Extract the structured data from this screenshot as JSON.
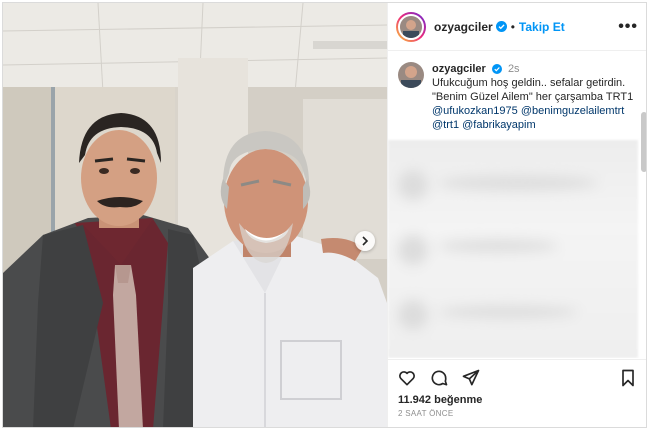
{
  "post": {
    "username": "ozyagciler",
    "follow_label": "Takip Et",
    "separator": "•",
    "more_label": "•••",
    "caption": {
      "username": "ozyagciler",
      "time_ago": "2s",
      "line1": "Ufukcuğum hoş geldin.. sefalar getirdin.",
      "line2": "\"Benim Güzel Ailem\" her çarşamba TRT1",
      "mention1": "@ufukozkan1975",
      "mention2": "@benimguzelailemtrt",
      "mention3": "@trt1",
      "mention4": "@fabrikayapim"
    },
    "likes": "11.942 beğenme",
    "timestamp": "2 SAAT ÖNCE"
  },
  "icons": {
    "verified": "verified-badge-icon",
    "more": "more-options-icon",
    "like": "heart-icon",
    "comment": "comment-icon",
    "share": "share-icon",
    "save": "bookmark-icon",
    "next": "chevron-right-icon"
  },
  "colors": {
    "accent": "#0095f6",
    "mention": "#00376b",
    "muted": "#8e8e8e"
  }
}
